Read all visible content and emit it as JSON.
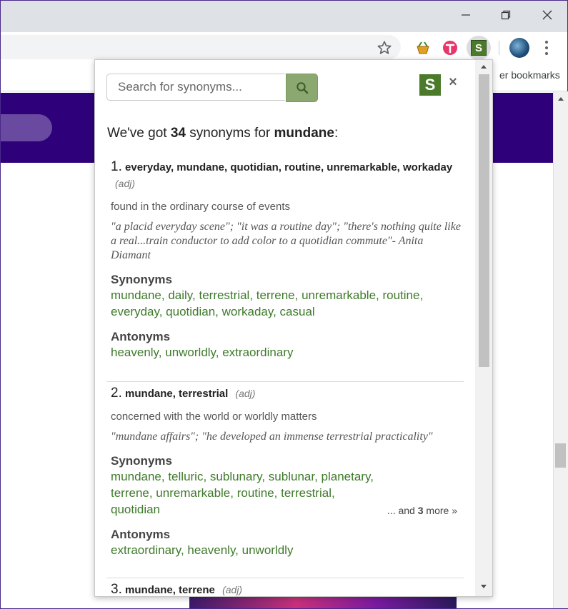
{
  "browser": {
    "bookmarks_text": "er bookmarks",
    "extension_icons": [
      "basket-extension-icon",
      "pink-t-extension-icon",
      "synonyms-s-extension-icon"
    ],
    "synonyms_ext_letter": "S"
  },
  "popup": {
    "search_placeholder": "Search for synonyms...",
    "logo_letter": "S",
    "close_label": "×",
    "heading": {
      "prefix": "We've got ",
      "count": "34",
      "middle": " synonyms for ",
      "word": "mundane",
      "suffix": ":"
    },
    "entries": [
      {
        "number": "1.",
        "words": "everyday, mundane, quotidian, routine, unremarkable, workaday",
        "pos": "(adj)",
        "gloss": "found in the ordinary course of events",
        "example": "\"a placid everyday scene\"; \"it was a routine day\"; \"there's nothing quite like a real...train conductor to add color to a quotidian commute\"- Anita Diamant",
        "synonyms_label": "Synonyms",
        "synonyms": "mundane, daily, terrestrial, terrene, unremarkable, routine, everyday, quotidian, workaday, casual",
        "antonyms_label": "Antonyms",
        "antonyms": "heavenly, unworldly, extraordinary"
      },
      {
        "number": "2.",
        "words": "mundane, terrestrial",
        "pos": "(adj)",
        "gloss": "concerned with the world or worldly matters",
        "example": "\"mundane affairs\"; \"he developed an immense terrestrial practicality\"",
        "synonyms_label": "Synonyms",
        "synonyms": "mundane, telluric, sublunary, sublunar, planetary, terrene, unremarkable, routine, terrestrial, quotidian",
        "more_prefix": "... and ",
        "more_count": "3",
        "more_suffix": " more »",
        "antonyms_label": "Antonyms",
        "antonyms": "extraordinary, heavenly, unworldly"
      },
      {
        "number": "3.",
        "words": "mundane, terrene",
        "pos": "(adj)"
      }
    ]
  }
}
